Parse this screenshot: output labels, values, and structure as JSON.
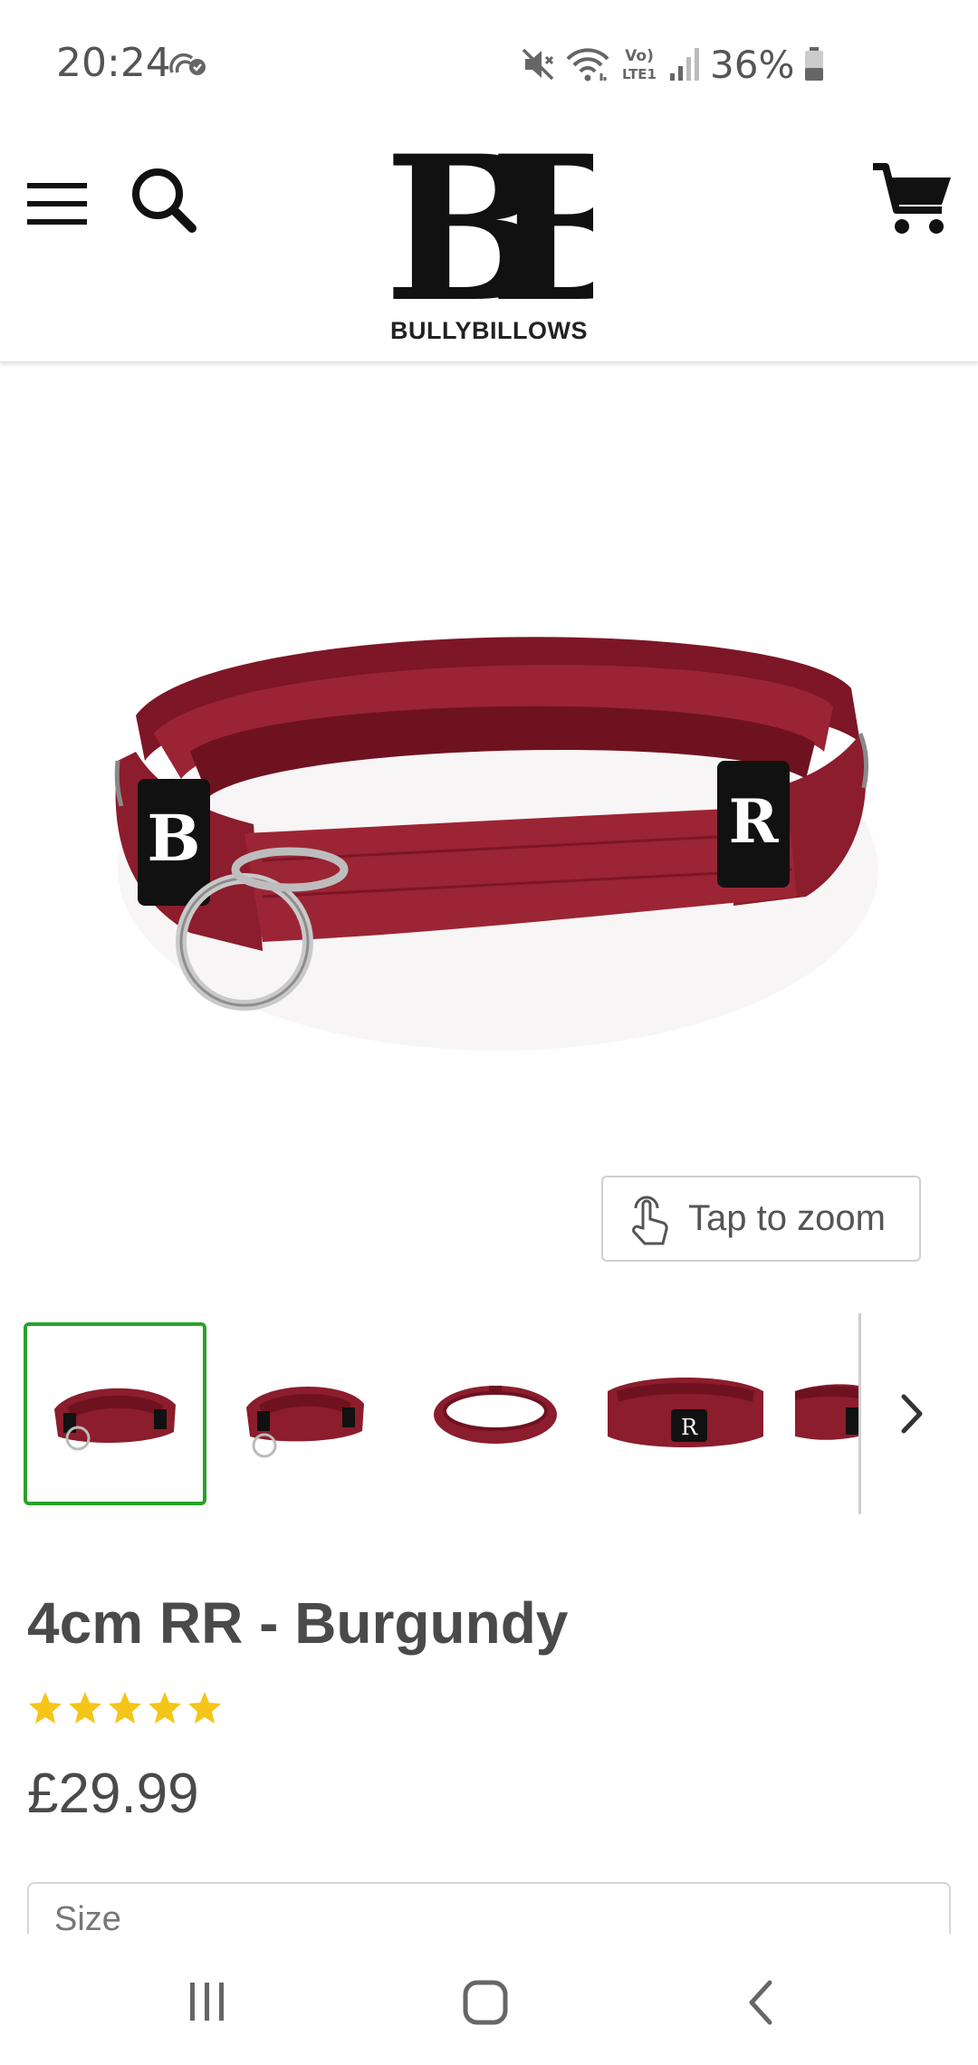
{
  "status_bar": {
    "time": "20:24",
    "battery": "36%",
    "icons": [
      "sync-icon",
      "mute-icon",
      "wifi-icon",
      "volte-lte1-icon",
      "signal-icon",
      "battery-icon"
    ]
  },
  "header": {
    "logo_text": "BULLYBILLOWS",
    "icons": [
      "menu-icon",
      "search-icon",
      "cart-icon"
    ]
  },
  "gallery": {
    "zoom_label": "Tap to zoom",
    "thumbnail_count": 5,
    "active_thumbnail": 1
  },
  "product": {
    "title": "4cm RR - Burgundy",
    "rating": 5,
    "price": "£29.99",
    "size_label": "Size"
  },
  "colors": {
    "burgundy": "#8c1d2c",
    "active_border": "#2aa12a",
    "star": "#f5c518",
    "text": "#4a4a4a"
  }
}
